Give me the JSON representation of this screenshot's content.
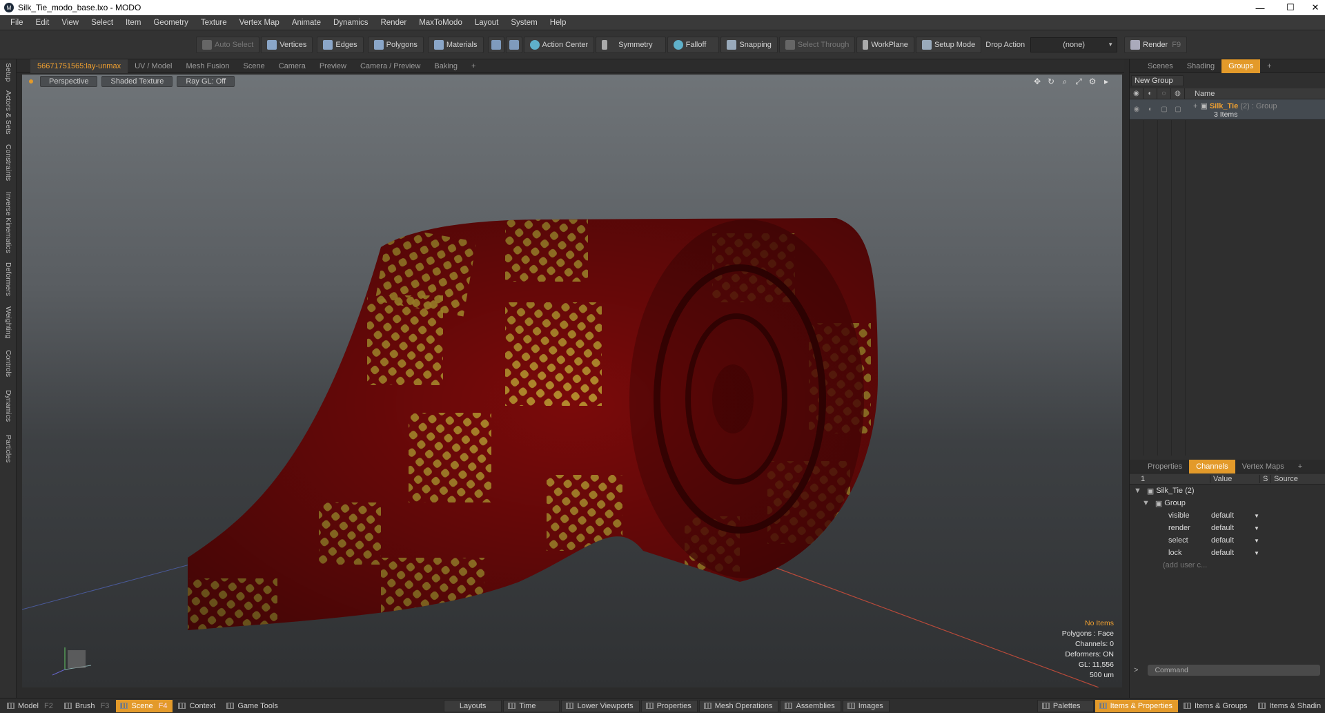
{
  "window": {
    "title": "Silk_Tie_modo_base.lxo - MODO",
    "controls": [
      "—",
      "☐",
      "✕"
    ]
  },
  "menu": [
    "File",
    "Edit",
    "View",
    "Select",
    "Item",
    "Geometry",
    "Texture",
    "Vertex Map",
    "Animate",
    "Dynamics",
    "Render",
    "MaxToModo",
    "Layout",
    "System",
    "Help"
  ],
  "toolbar": {
    "auto_select": "Auto Select",
    "vertices": "Vertices",
    "edges": "Edges",
    "polygons": "Polygons",
    "materials": "Materials",
    "action_center": "Action Center",
    "symmetry": "Symmetry",
    "falloff": "Falloff",
    "snapping": "Snapping",
    "select_through": "Select Through",
    "workplane": "WorkPlane",
    "setup_mode": "Setup Mode",
    "drop_action": "Drop Action",
    "drop_value": "(none)",
    "render": "Render",
    "render_key": "F9"
  },
  "left_tabs": [
    "Setup",
    "Actors & Sets",
    "Constraints",
    "Inverse Kinematics",
    "Deformers",
    "Weighting",
    "Controls",
    "Dynamics",
    "Particles"
  ],
  "view_tabs": [
    "56671751565:lay-unmax",
    "UV / Model",
    "Mesh Fusion",
    "Scene",
    "Camera",
    "Preview",
    "Camera / Preview",
    "Baking",
    "+"
  ],
  "viewport": {
    "mode": "Perspective",
    "shading": "Shaded Texture",
    "raygl": "Ray GL: Off",
    "stats": [
      "No Items",
      "Polygons : Face",
      "Channels: 0",
      "Deformers: ON",
      "GL: 11,556",
      "500 um"
    ]
  },
  "right_top_tabs": [
    "Scenes",
    "Shading",
    "Groups",
    "+"
  ],
  "groups": {
    "new_group": "New Group",
    "name_col": "Name",
    "item_name": "Silk_Tie",
    "item_count": "(2)",
    "item_type": ": Group",
    "item_sub": "3 Items"
  },
  "right_bottom_tabs": [
    "Properties",
    "Channels",
    "Vertex Maps",
    "+"
  ],
  "channels": {
    "col_num": "1",
    "col_value": "Value",
    "col_s": "S",
    "col_source": "Source",
    "root": "Silk_Tie (2)",
    "group": "Group",
    "rows": [
      {
        "name": "visible",
        "value": "default"
      },
      {
        "name": "render",
        "value": "default"
      },
      {
        "name": "select",
        "value": "default"
      },
      {
        "name": "lock",
        "value": "default"
      }
    ],
    "add": "(add user c..."
  },
  "command": {
    "placeholder": "Command"
  },
  "bottom": {
    "model": "Model",
    "model_key": "F2",
    "brush": "Brush",
    "brush_key": "F3",
    "scene": "Scene",
    "scene_key": "F4",
    "context": "Context",
    "game_tools": "Game Tools",
    "layouts": "Layouts",
    "time": "Time",
    "lower_viewports": "Lower Viewports",
    "properties": "Properties",
    "mesh_operations": "Mesh Operations",
    "assemblies": "Assemblies",
    "images": "Images",
    "palettes": "Palettes",
    "items_properties": "Items & Properties",
    "items_groups": "Items & Groups",
    "items_shading": "Items & Shadin"
  },
  "colors": {
    "accent": "#e39a2a",
    "tie_red": "#7a0a0a",
    "tie_pattern": "#c8b23a"
  }
}
